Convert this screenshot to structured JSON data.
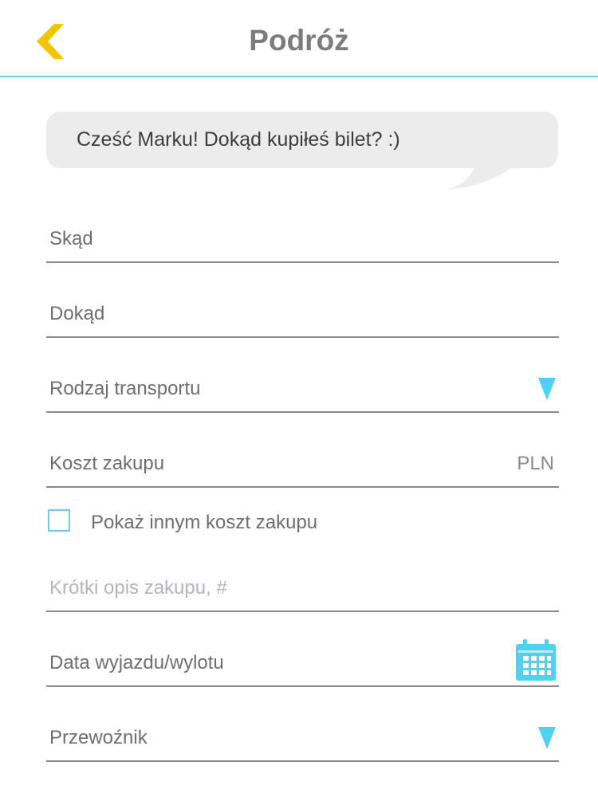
{
  "header": {
    "title": "Podróż",
    "back_icon": "chevron-left-icon",
    "back_color": "#f5c400"
  },
  "bubble": {
    "text": "Cześć Marku! Dokąd kupiłeś bilet? :)"
  },
  "form": {
    "from_placeholder": "Skąd",
    "to_placeholder": "Dokąd",
    "transport_placeholder": "Rodzaj transportu",
    "cost_placeholder": "Koszt zakupu",
    "cost_currency": "PLN",
    "show_cost_label": "Pokaż innym koszt zakupu",
    "show_cost_checked": false,
    "description_placeholder": "Krótki opis zakupu, #",
    "date_placeholder": "Data wyjazdu/wylotu",
    "carrier_placeholder": "Przewoźnik"
  },
  "colors": {
    "accent": "#6fcde9",
    "back_arrow": "#f5c400",
    "dropdown": "#4fd1f0"
  }
}
